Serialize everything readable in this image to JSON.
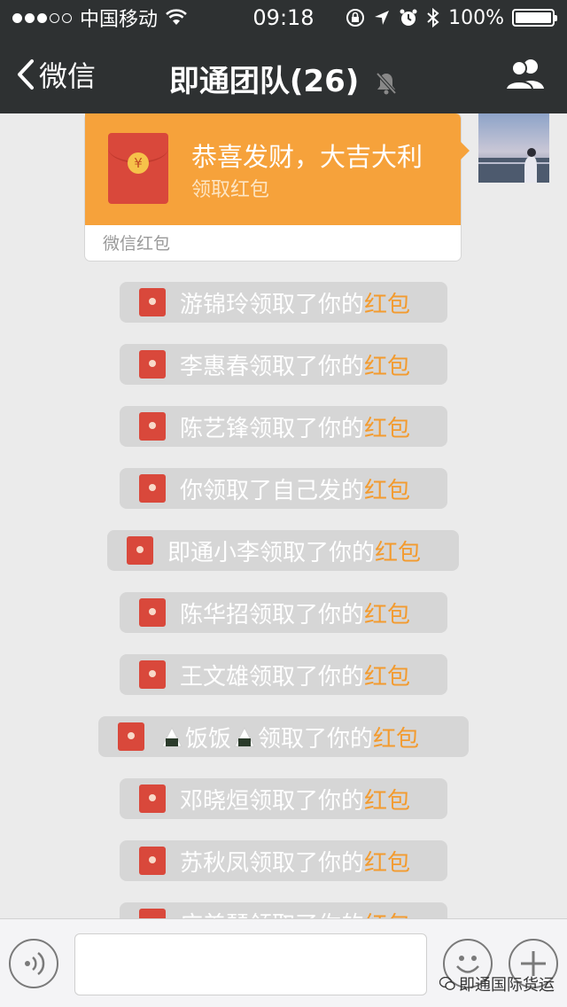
{
  "status_bar": {
    "carrier": "中国移动",
    "time": "09:18",
    "battery": "100%",
    "battery_level": 1.0
  },
  "nav": {
    "back_label": "微信",
    "title": "即通团队(26)"
  },
  "red_packet": {
    "greeting": "恭喜发财，大吉大利",
    "action": "领取红包",
    "footer": "微信红包",
    "coin_symbol": "¥",
    "color": "#f6a23b"
  },
  "messages": [
    {
      "prefix": "游锦玲领取了你的",
      "suffix": "红包"
    },
    {
      "prefix": "李惠春领取了你的",
      "suffix": "红包"
    },
    {
      "prefix": "陈艺锋领取了你的",
      "suffix": "红包"
    },
    {
      "prefix": "你领取了自己发的",
      "suffix": "红包"
    },
    {
      "prefix": "即通小李领取了你的",
      "suffix": "红包"
    },
    {
      "prefix": "陈华招领取了你的",
      "suffix": "红包"
    },
    {
      "prefix": "王文雄领取了你的",
      "suffix": "红包"
    },
    {
      "name": "饭饭",
      "prefix": "领取了你的",
      "suffix": "红包"
    },
    {
      "prefix": "邓晓烜领取了你的",
      "suffix": "红包"
    },
    {
      "prefix": "苏秋凤领取了你的",
      "suffix": "红包"
    },
    {
      "prefix": "庄美琴领取了你的",
      "suffix": "红包"
    }
  ],
  "watermark": "即通国际货运",
  "colors": {
    "bar": "#2e3132",
    "chat_bg": "#ebebeb",
    "accent_orange": "#f39b2f",
    "envelope_red": "#d9483b"
  }
}
